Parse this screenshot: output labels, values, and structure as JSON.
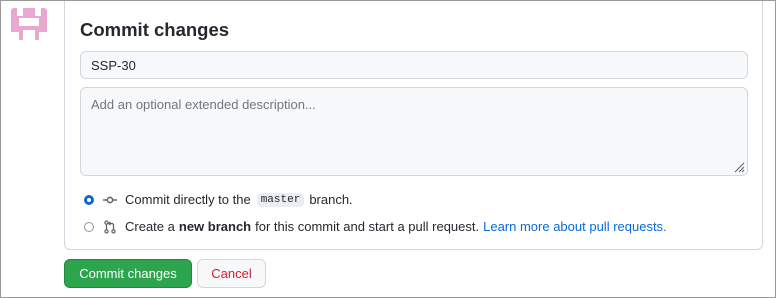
{
  "form": {
    "title": "Commit changes",
    "summary_value": "SSP-30",
    "description_placeholder": "Add an optional extended description..."
  },
  "options": {
    "direct": {
      "text_before": "Commit directly to the",
      "branch": "master",
      "text_after": "branch.",
      "selected": true,
      "icon": "git-commit-icon"
    },
    "new_branch": {
      "text_before": "Create a",
      "bold": "new branch",
      "text_after": "for this commit and start a pull request.",
      "link": "Learn more about pull requests.",
      "selected": false,
      "icon": "git-pull-request-icon"
    }
  },
  "buttons": {
    "commit": "Commit changes",
    "cancel": "Cancel"
  },
  "colors": {
    "primary_green": "#2da44e",
    "link_blue": "#0969da",
    "cancel_red": "#cf222e",
    "avatar_pink": "#e8a8d0"
  }
}
